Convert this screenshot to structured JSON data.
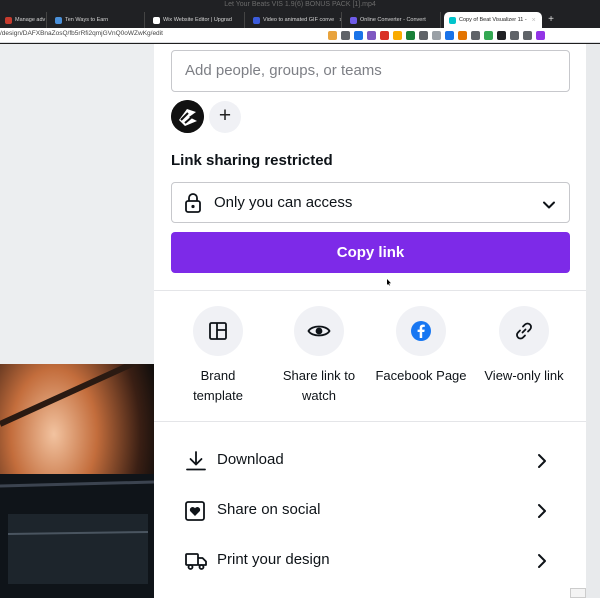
{
  "browser": {
    "window_title": "Let Your Beats VIS 1.9(6) BONUS PACK [1].mp4",
    "tabs": [
      {
        "label": "Manage adv",
        "favicon_color": "#c63b2e",
        "active": false
      },
      {
        "label": "Ten Ways to Earn",
        "favicon_color": "#4a90d9",
        "active": false
      },
      {
        "label": "Wix Website Editor | Upgrad",
        "favicon_color": "#ffffff",
        "active": false
      },
      {
        "label": "Video to animated GIF conve",
        "favicon_color": "#3b5bdb",
        "active": false
      },
      {
        "label": "Online Converter - Convert",
        "favicon_color": "#6e5be8",
        "active": false
      },
      {
        "label": "Copy of Beat Visualizer 11 -",
        "favicon_color": "#00c4cc",
        "active": true
      }
    ],
    "new_tab_label": "+",
    "tab_close_glyph": "×",
    "url": "/design/DAFXBnaZosQ/fb5rRfi2qmjGVnQ0oWZwKg/edit",
    "extension_colors": [
      "#e8a33d",
      "#5f6368",
      "#1a73e8",
      "#7e57c2",
      "#d93025",
      "#f9ab00",
      "#188038",
      "#5f6368",
      "#9aa0a6",
      "#1a73e8",
      "#e37400",
      "#5f6368",
      "#34a853",
      "#202124",
      "#5f6368",
      "#5f6368",
      "#9334e6"
    ]
  },
  "share_panel": {
    "add_people_placeholder": "Add people, groups, or teams",
    "add_person_glyph": "+",
    "link_sharing_heading": "Link sharing restricted",
    "access_select": {
      "value": "Only you can access",
      "icon": "lock-icon"
    },
    "copy_link_label": "Copy link",
    "accent_color": "#7d2ae8",
    "share_options": [
      {
        "label": "Brand template",
        "icon": "template-icon"
      },
      {
        "label": "Share link to watch",
        "icon": "eye-icon"
      },
      {
        "label": "Facebook Page",
        "icon": "facebook-icon"
      },
      {
        "label": "View-only link",
        "icon": "link-icon"
      }
    ],
    "actions": [
      {
        "label": "Download",
        "icon": "download-icon"
      },
      {
        "label": "Share on social",
        "icon": "heart-box-icon"
      },
      {
        "label": "Print your design",
        "icon": "truck-icon"
      }
    ]
  }
}
